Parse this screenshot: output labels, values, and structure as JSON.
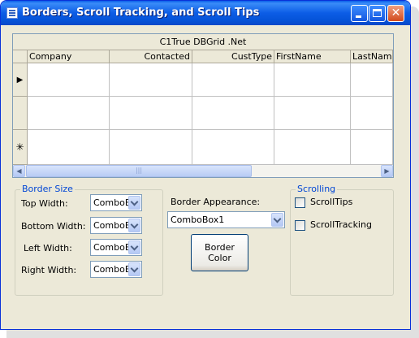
{
  "window": {
    "title": "Borders, Scroll Tracking, and Scroll Tips",
    "title_icon": "form-icon",
    "controls": {
      "minimize": "minimize-icon",
      "maximize": "maximize-icon",
      "close_glyph": "✕"
    }
  },
  "grid": {
    "caption": "C1True DBGrid .Net",
    "columns": [
      "Company",
      "Contacted",
      "CustType",
      "FirstName",
      "LastNam"
    ],
    "row_indicators": [
      "▶",
      "",
      "✳"
    ],
    "scroll_thumb_glyph": "|||",
    "scroll_left_glyph": "◀",
    "scroll_right_glyph": "▶"
  },
  "border_size": {
    "title": "Border Size",
    "rows": [
      {
        "label": "Top Width:",
        "value": "ComboB"
      },
      {
        "label": "Bottom Width:",
        "value": "ComboB"
      },
      {
        "label": "Left Width:",
        "value": "ComboB"
      },
      {
        "label": "Right Width:",
        "value": "ComboB"
      }
    ]
  },
  "appearance": {
    "label": "Border Appearance:",
    "value": "ComboBox1",
    "button_line1": "Border",
    "button_line2": "Color"
  },
  "scrolling": {
    "title": "Scrolling",
    "options": [
      {
        "label": "ScrollTips",
        "checked": false
      },
      {
        "label": "ScrollTracking",
        "checked": false
      }
    ]
  },
  "colors": {
    "titlebar": "#0a5ee8",
    "window_bg": "#ece9d8",
    "group_title": "#0046d5",
    "grid_bg": "#808080"
  }
}
